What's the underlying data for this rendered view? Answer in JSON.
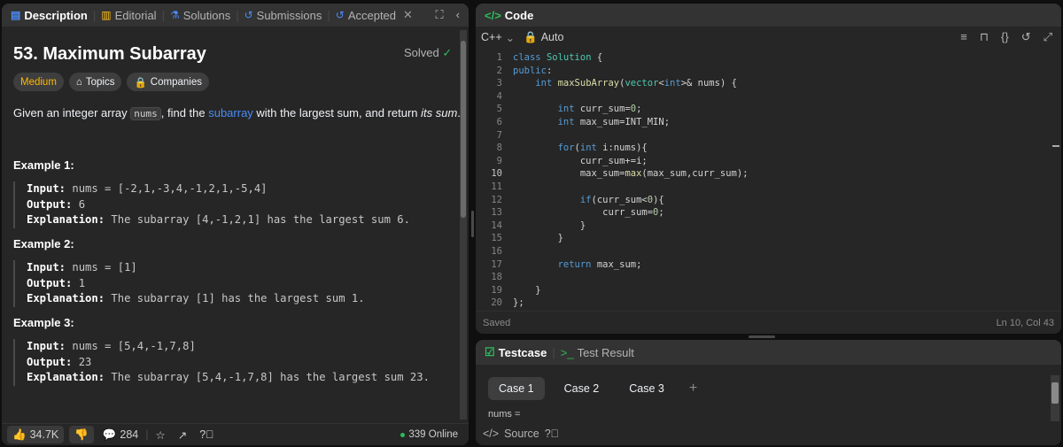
{
  "left_tabs": {
    "description": "Description",
    "editorial": "Editorial",
    "solutions": "Solutions",
    "submissions": "Submissions",
    "accepted": "Accepted"
  },
  "problem": {
    "title": "53. Maximum Subarray",
    "solved": "Solved",
    "difficulty": "Medium",
    "topics": "Topics",
    "companies": "Companies",
    "statement_pre": "Given an integer array ",
    "statement_code": "nums",
    "statement_mid": ", find the ",
    "statement_link": "subarray",
    "statement_post": " with the largest sum, and return ",
    "statement_em": "its sum",
    "statement_end": ".",
    "examples": [
      {
        "heading": "Example 1:",
        "input_label": "Input:",
        "input": " nums = [-2,1,-3,4,-1,2,1,-5,4]",
        "output_label": "Output:",
        "output": " 6",
        "explanation_label": "Explanation:",
        "explanation": " The subarray [4,-1,2,1] has the largest sum 6."
      },
      {
        "heading": "Example 2:",
        "input_label": "Input:",
        "input": " nums = [1]",
        "output_label": "Output:",
        "output": " 1",
        "explanation_label": "Explanation:",
        "explanation": " The subarray [1] has the largest sum 1."
      },
      {
        "heading": "Example 3:",
        "input_label": "Input:",
        "input": " nums = [5,4,-1,7,8]",
        "output_label": "Output:",
        "output": " 23",
        "explanation_label": "Explanation:",
        "explanation": " The subarray [5,4,-1,7,8] has the largest sum 23."
      }
    ]
  },
  "bottom_bar": {
    "likes": "34.7K",
    "comments": "284",
    "online": "339 Online"
  },
  "code_panel": {
    "title": "Code",
    "language": "C++",
    "mode": "Auto",
    "status": "Saved",
    "cursor": "Ln 10, Col 43",
    "lines": [
      "class Solution {",
      "public:",
      "    int maxSubArray(vector<int>& nums) {",
      "",
      "        int curr_sum=0;",
      "        int max_sum=INT_MIN;",
      "",
      "        for(int i:nums){",
      "            curr_sum+=i;",
      "            max_sum=max(max_sum,curr_sum);",
      "",
      "            if(curr_sum<0){",
      "                curr_sum=0;",
      "            }",
      "        }",
      "",
      "        return max_sum;",
      "",
      "    }",
      "};"
    ],
    "line_numbers": [
      "1",
      "2",
      "3",
      "4",
      "5",
      "6",
      "7",
      "8",
      "9",
      "10",
      "11",
      "12",
      "13",
      "14",
      "15",
      "16",
      "17",
      "18",
      "19",
      "20"
    ]
  },
  "test_panel": {
    "testcase_tab": "Testcase",
    "result_tab": "Test Result",
    "cases": [
      "Case 1",
      "Case 2",
      "Case 3"
    ],
    "field_label": "nums =",
    "source": "Source"
  },
  "colors": {
    "accent_blue": "#4a8cf7",
    "medium_yellow": "#ffb800",
    "solved_green": "#2cbb5d"
  }
}
